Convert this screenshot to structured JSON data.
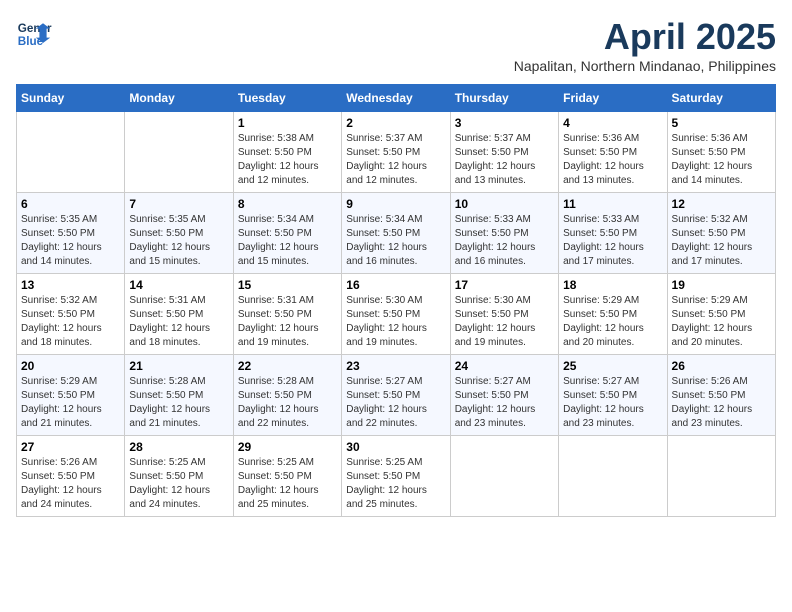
{
  "header": {
    "logo_line1": "General",
    "logo_line2": "Blue",
    "month": "April 2025",
    "location": "Napalitan, Northern Mindanao, Philippines"
  },
  "weekdays": [
    "Sunday",
    "Monday",
    "Tuesday",
    "Wednesday",
    "Thursday",
    "Friday",
    "Saturday"
  ],
  "weeks": [
    [
      {
        "day": "",
        "sunrise": "",
        "sunset": "",
        "daylight": ""
      },
      {
        "day": "",
        "sunrise": "",
        "sunset": "",
        "daylight": ""
      },
      {
        "day": "1",
        "sunrise": "Sunrise: 5:38 AM",
        "sunset": "Sunset: 5:50 PM",
        "daylight": "Daylight: 12 hours and 12 minutes."
      },
      {
        "day": "2",
        "sunrise": "Sunrise: 5:37 AM",
        "sunset": "Sunset: 5:50 PM",
        "daylight": "Daylight: 12 hours and 12 minutes."
      },
      {
        "day": "3",
        "sunrise": "Sunrise: 5:37 AM",
        "sunset": "Sunset: 5:50 PM",
        "daylight": "Daylight: 12 hours and 13 minutes."
      },
      {
        "day": "4",
        "sunrise": "Sunrise: 5:36 AM",
        "sunset": "Sunset: 5:50 PM",
        "daylight": "Daylight: 12 hours and 13 minutes."
      },
      {
        "day": "5",
        "sunrise": "Sunrise: 5:36 AM",
        "sunset": "Sunset: 5:50 PM",
        "daylight": "Daylight: 12 hours and 14 minutes."
      }
    ],
    [
      {
        "day": "6",
        "sunrise": "Sunrise: 5:35 AM",
        "sunset": "Sunset: 5:50 PM",
        "daylight": "Daylight: 12 hours and 14 minutes."
      },
      {
        "day": "7",
        "sunrise": "Sunrise: 5:35 AM",
        "sunset": "Sunset: 5:50 PM",
        "daylight": "Daylight: 12 hours and 15 minutes."
      },
      {
        "day": "8",
        "sunrise": "Sunrise: 5:34 AM",
        "sunset": "Sunset: 5:50 PM",
        "daylight": "Daylight: 12 hours and 15 minutes."
      },
      {
        "day": "9",
        "sunrise": "Sunrise: 5:34 AM",
        "sunset": "Sunset: 5:50 PM",
        "daylight": "Daylight: 12 hours and 16 minutes."
      },
      {
        "day": "10",
        "sunrise": "Sunrise: 5:33 AM",
        "sunset": "Sunset: 5:50 PM",
        "daylight": "Daylight: 12 hours and 16 minutes."
      },
      {
        "day": "11",
        "sunrise": "Sunrise: 5:33 AM",
        "sunset": "Sunset: 5:50 PM",
        "daylight": "Daylight: 12 hours and 17 minutes."
      },
      {
        "day": "12",
        "sunrise": "Sunrise: 5:32 AM",
        "sunset": "Sunset: 5:50 PM",
        "daylight": "Daylight: 12 hours and 17 minutes."
      }
    ],
    [
      {
        "day": "13",
        "sunrise": "Sunrise: 5:32 AM",
        "sunset": "Sunset: 5:50 PM",
        "daylight": "Daylight: 12 hours and 18 minutes."
      },
      {
        "day": "14",
        "sunrise": "Sunrise: 5:31 AM",
        "sunset": "Sunset: 5:50 PM",
        "daylight": "Daylight: 12 hours and 18 minutes."
      },
      {
        "day": "15",
        "sunrise": "Sunrise: 5:31 AM",
        "sunset": "Sunset: 5:50 PM",
        "daylight": "Daylight: 12 hours and 19 minutes."
      },
      {
        "day": "16",
        "sunrise": "Sunrise: 5:30 AM",
        "sunset": "Sunset: 5:50 PM",
        "daylight": "Daylight: 12 hours and 19 minutes."
      },
      {
        "day": "17",
        "sunrise": "Sunrise: 5:30 AM",
        "sunset": "Sunset: 5:50 PM",
        "daylight": "Daylight: 12 hours and 19 minutes."
      },
      {
        "day": "18",
        "sunrise": "Sunrise: 5:29 AM",
        "sunset": "Sunset: 5:50 PM",
        "daylight": "Daylight: 12 hours and 20 minutes."
      },
      {
        "day": "19",
        "sunrise": "Sunrise: 5:29 AM",
        "sunset": "Sunset: 5:50 PM",
        "daylight": "Daylight: 12 hours and 20 minutes."
      }
    ],
    [
      {
        "day": "20",
        "sunrise": "Sunrise: 5:29 AM",
        "sunset": "Sunset: 5:50 PM",
        "daylight": "Daylight: 12 hours and 21 minutes."
      },
      {
        "day": "21",
        "sunrise": "Sunrise: 5:28 AM",
        "sunset": "Sunset: 5:50 PM",
        "daylight": "Daylight: 12 hours and 21 minutes."
      },
      {
        "day": "22",
        "sunrise": "Sunrise: 5:28 AM",
        "sunset": "Sunset: 5:50 PM",
        "daylight": "Daylight: 12 hours and 22 minutes."
      },
      {
        "day": "23",
        "sunrise": "Sunrise: 5:27 AM",
        "sunset": "Sunset: 5:50 PM",
        "daylight": "Daylight: 12 hours and 22 minutes."
      },
      {
        "day": "24",
        "sunrise": "Sunrise: 5:27 AM",
        "sunset": "Sunset: 5:50 PM",
        "daylight": "Daylight: 12 hours and 23 minutes."
      },
      {
        "day": "25",
        "sunrise": "Sunrise: 5:27 AM",
        "sunset": "Sunset: 5:50 PM",
        "daylight": "Daylight: 12 hours and 23 minutes."
      },
      {
        "day": "26",
        "sunrise": "Sunrise: 5:26 AM",
        "sunset": "Sunset: 5:50 PM",
        "daylight": "Daylight: 12 hours and 23 minutes."
      }
    ],
    [
      {
        "day": "27",
        "sunrise": "Sunrise: 5:26 AM",
        "sunset": "Sunset: 5:50 PM",
        "daylight": "Daylight: 12 hours and 24 minutes."
      },
      {
        "day": "28",
        "sunrise": "Sunrise: 5:25 AM",
        "sunset": "Sunset: 5:50 PM",
        "daylight": "Daylight: 12 hours and 24 minutes."
      },
      {
        "day": "29",
        "sunrise": "Sunrise: 5:25 AM",
        "sunset": "Sunset: 5:50 PM",
        "daylight": "Daylight: 12 hours and 25 minutes."
      },
      {
        "day": "30",
        "sunrise": "Sunrise: 5:25 AM",
        "sunset": "Sunset: 5:50 PM",
        "daylight": "Daylight: 12 hours and 25 minutes."
      },
      {
        "day": "",
        "sunrise": "",
        "sunset": "",
        "daylight": ""
      },
      {
        "day": "",
        "sunrise": "",
        "sunset": "",
        "daylight": ""
      },
      {
        "day": "",
        "sunrise": "",
        "sunset": "",
        "daylight": ""
      }
    ]
  ]
}
